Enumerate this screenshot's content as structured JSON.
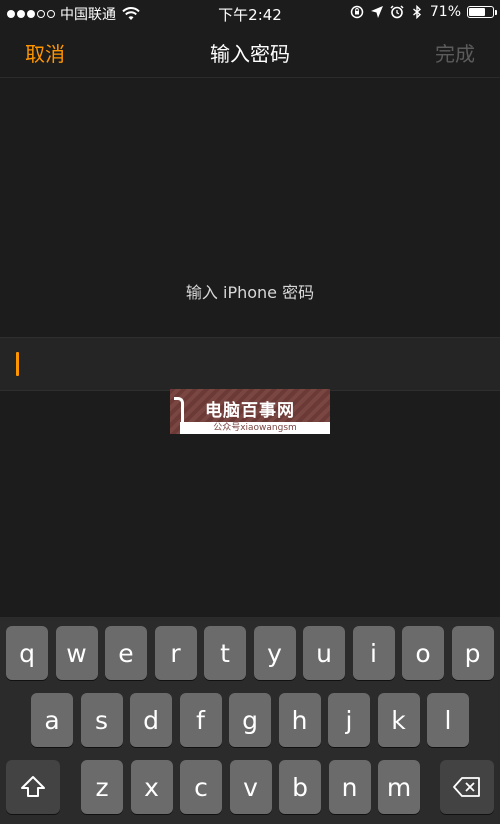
{
  "status_bar": {
    "carrier": "中国联通",
    "time": "下午2:42",
    "battery": "71%",
    "battery_level": 0.71,
    "signal_bars": 3,
    "signal_total": 5
  },
  "nav": {
    "cancel_label": "取消",
    "title": "输入密码",
    "done_label": "完成"
  },
  "prompt": "输入 iPhone 密码",
  "password_field": {
    "value": ""
  },
  "watermark": {
    "title": "电脑百事网",
    "subtitle": "公众号xiaowangsm"
  },
  "keyboard": {
    "row1": [
      "q",
      "w",
      "e",
      "r",
      "t",
      "y",
      "u",
      "i",
      "o",
      "p"
    ],
    "row2": [
      "a",
      "s",
      "d",
      "f",
      "g",
      "h",
      "j",
      "k",
      "l"
    ],
    "row3": [
      "z",
      "x",
      "c",
      "v",
      "b",
      "n",
      "m"
    ],
    "shift_icon": "shift-icon",
    "delete_icon": "delete-icon"
  },
  "colors": {
    "accent": "#ff9500",
    "background": "#1c1c1c",
    "key": "#6b6b6b",
    "key_func": "#434343"
  }
}
